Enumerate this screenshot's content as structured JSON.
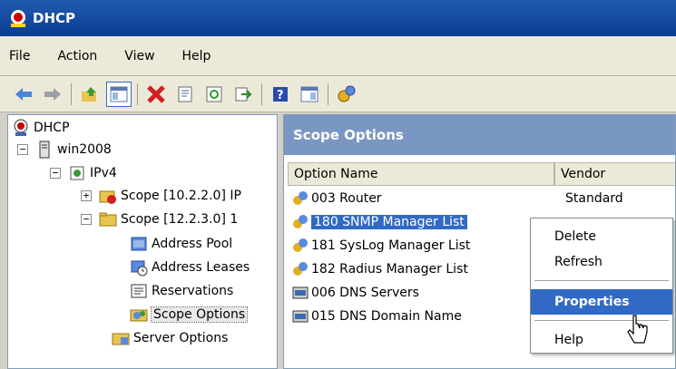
{
  "window": {
    "title": "DHCP"
  },
  "menu": [
    "File",
    "Action",
    "View",
    "Help"
  ],
  "toolbar": [
    "back",
    "forward",
    "up",
    "show-hide-tree",
    "delete",
    "properties",
    "refresh",
    "export",
    "help",
    "view",
    "dhcp-options"
  ],
  "tree": {
    "root": "DHCP",
    "server": "win2008",
    "ipv4": "IPv4",
    "scope1": "Scope [10.2.2.0] IP",
    "scope2": "Scope [12.2.3.0] 1",
    "address_pool": "Address Pool",
    "address_leases": "Address Leases",
    "reservations": "Reservations",
    "scope_options": "Scope Options",
    "server_options": "Server Options"
  },
  "panel": {
    "title": "Scope Options",
    "col_name": "Option Name",
    "col_vendor": "Vendor",
    "rows": [
      {
        "name": "003 Router",
        "vendor": "Standard"
      },
      {
        "name": "180 SNMP Manager List",
        "vendor": ""
      },
      {
        "name": "181 SysLog Manager List",
        "vendor": ""
      },
      {
        "name": "182 Radius Manager List",
        "vendor": ""
      },
      {
        "name": "006 DNS Servers",
        "vendor": ""
      },
      {
        "name": "015 DNS Domain Name",
        "vendor": ""
      }
    ]
  },
  "context_menu": {
    "delete": "Delete",
    "refresh": "Refresh",
    "properties": "Properties",
    "help": "Help"
  },
  "colors": {
    "title_bar": "#0b3d91",
    "panel_header": "#7a96c2",
    "selection": "#316ac5"
  }
}
